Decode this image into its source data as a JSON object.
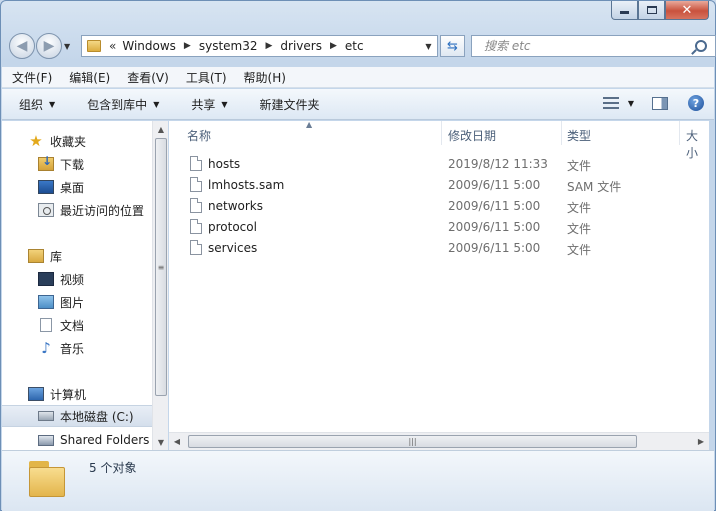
{
  "window": {
    "controls": {
      "minimize": "minimize",
      "maximize": "maximize",
      "close": "✕"
    }
  },
  "nav": {
    "back_icon": "back-arrow-icon",
    "forward_icon": "forward-arrow-icon",
    "breadcrumb_overflow": "«",
    "breadcrumbs": [
      "Windows",
      "system32",
      "drivers",
      "etc"
    ],
    "search_placeholder": "搜索 etc"
  },
  "menubar": [
    "文件(F)",
    "编辑(E)",
    "查看(V)",
    "工具(T)",
    "帮助(H)"
  ],
  "toolbar": {
    "organize": "组织",
    "include_in_library": "包含到库中",
    "share": "共享",
    "new_folder": "新建文件夹"
  },
  "sidebar": {
    "favorites": {
      "label": "收藏夹",
      "items": [
        "下载",
        "桌面",
        "最近访问的位置"
      ]
    },
    "libraries": {
      "label": "库",
      "items": [
        "视频",
        "图片",
        "文档",
        "音乐"
      ]
    },
    "computer": {
      "label": "计算机",
      "items": [
        "本地磁盘 (C:)",
        "Shared Folders"
      ]
    }
  },
  "columns": [
    "名称",
    "修改日期",
    "类型",
    "大小"
  ],
  "files": [
    {
      "name": "hosts",
      "modified": "2019/8/12 11:33",
      "type": "文件"
    },
    {
      "name": "lmhosts.sam",
      "modified": "2009/6/11 5:00",
      "type": "SAM 文件"
    },
    {
      "name": "networks",
      "modified": "2009/6/11 5:00",
      "type": "文件"
    },
    {
      "name": "protocol",
      "modified": "2009/6/11 5:00",
      "type": "文件"
    },
    {
      "name": "services",
      "modified": "2009/6/11 5:00",
      "type": "文件"
    }
  ],
  "status": {
    "item_count": "5 个对象"
  }
}
